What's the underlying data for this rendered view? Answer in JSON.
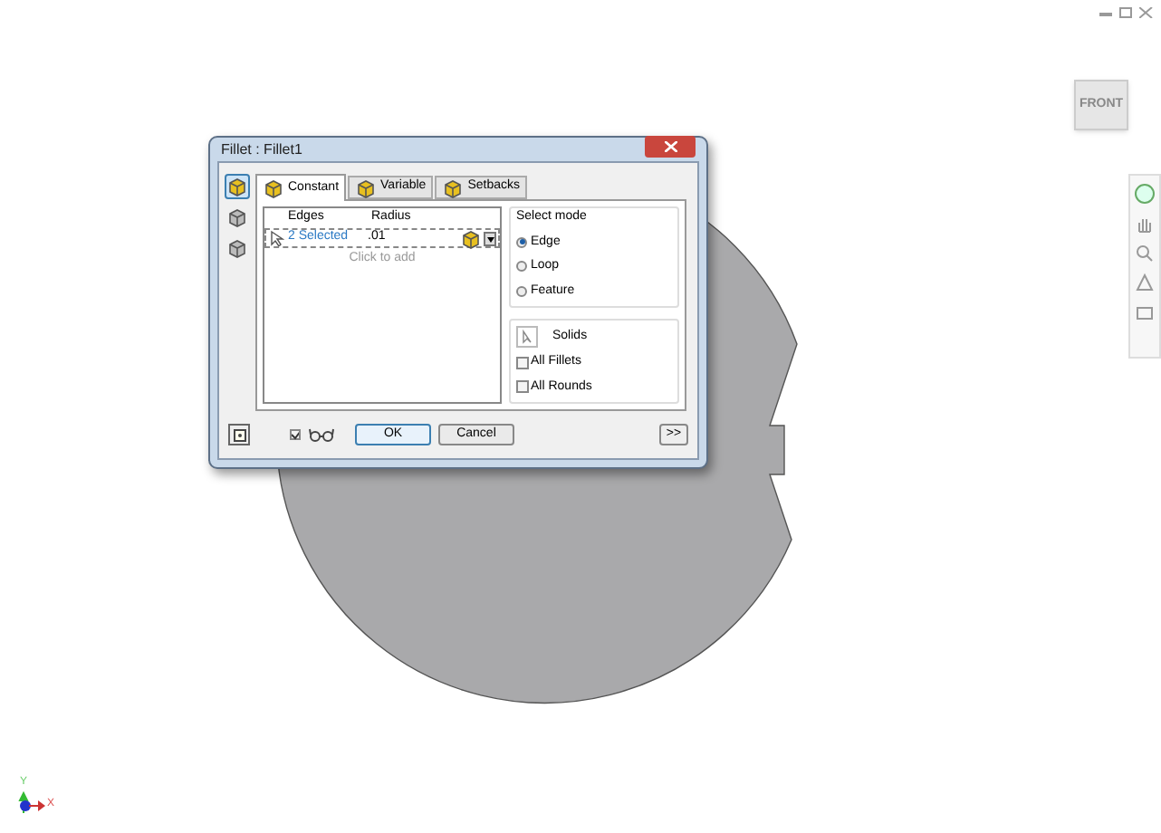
{
  "view_cube": {
    "label": "FRONT"
  },
  "dialog": {
    "title": "Fillet : Fillet1",
    "side_modes": [
      {
        "selected": true
      },
      {
        "selected": false
      },
      {
        "selected": false
      }
    ],
    "tabs": [
      {
        "label": "Constant",
        "selected": true
      },
      {
        "label": "Variable",
        "selected": false
      },
      {
        "label": "Setbacks",
        "selected": false
      }
    ],
    "table": {
      "columns": [
        "Edges",
        "Radius"
      ],
      "rows": [
        {
          "edges": "2 Selected",
          "radius": ".01"
        }
      ],
      "add_hint": "Click to add"
    },
    "select_mode": {
      "title": "Select mode",
      "options": [
        {
          "label": "Edge",
          "selected": true
        },
        {
          "label": "Loop",
          "selected": false
        },
        {
          "label": "Feature",
          "selected": false
        }
      ]
    },
    "solids": {
      "label": "Solids"
    },
    "checkboxes": [
      {
        "label": "All Fillets",
        "checked": false
      },
      {
        "label": "All Rounds",
        "checked": false
      }
    ],
    "preview": {
      "checked": true
    },
    "buttons": {
      "ok": "OK",
      "cancel": "Cancel",
      "more": ">>"
    }
  },
  "axes": {
    "x": "X",
    "y": "Y"
  }
}
